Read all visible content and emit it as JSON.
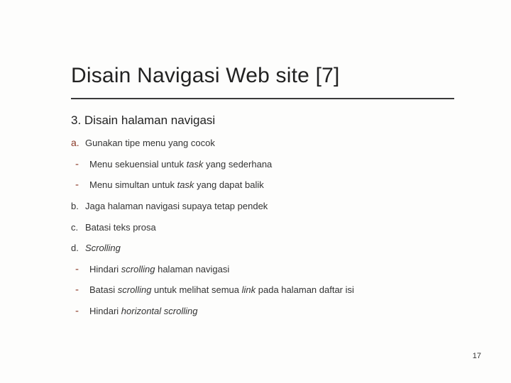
{
  "title": "Disain Navigasi Web site [7]",
  "subhead": "3. Disain halaman navigasi",
  "items": [
    {
      "marker": "a.",
      "cls": "lettered first",
      "html": "Gunakan tipe menu yang cocok"
    },
    {
      "marker": "-",
      "cls": "sub",
      "html": "Menu sekuensial untuk <span class=\"italic\">task</span> yang sederhana"
    },
    {
      "marker": "-",
      "cls": "sub",
      "html": "Menu simultan untuk <span class=\"italic\">task</span> yang dapat balik"
    },
    {
      "marker": "b.",
      "cls": "lettered",
      "html": "Jaga halaman navigasi supaya tetap pendek"
    },
    {
      "marker": "c.",
      "cls": "lettered",
      "html": "Batasi teks prosa"
    },
    {
      "marker": "d.",
      "cls": "lettered",
      "html": "<span class=\"italic\">Scrolling</span>"
    },
    {
      "marker": "-",
      "cls": "sub",
      "html": "Hindari <span class=\"italic\">scrolling</span> halaman navigasi"
    },
    {
      "marker": "-",
      "cls": "sub",
      "html": "Batasi <span class=\"italic\">scrolling</span> untuk melihat semua <span class=\"italic\">link</span> pada halaman daftar isi"
    },
    {
      "marker": "-",
      "cls": "sub",
      "html": "Hindari <span class=\"italic\">horizontal scrolling</span>"
    }
  ],
  "page_number": "17"
}
